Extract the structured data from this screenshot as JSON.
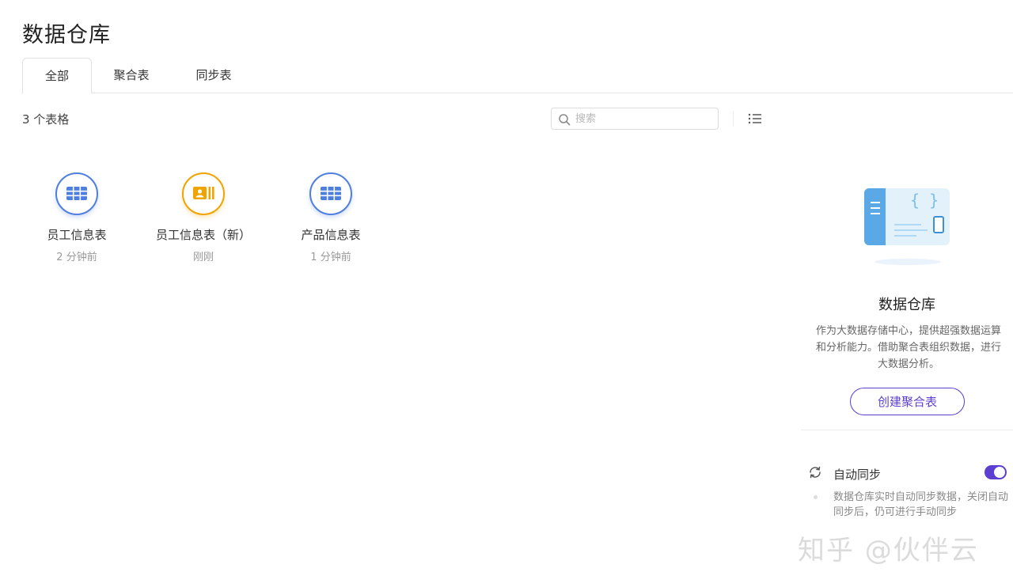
{
  "page": {
    "title": "数据仓库"
  },
  "tabs": [
    {
      "label": "全部",
      "active": true
    },
    {
      "label": "聚合表",
      "active": false
    },
    {
      "label": "同步表",
      "active": false
    }
  ],
  "toolbar": {
    "count_text": "3 个表格",
    "search_placeholder": "搜索",
    "search_icon": "search-icon",
    "view_icon": "list-view-icon"
  },
  "tables": [
    {
      "name": "员工信息表",
      "time": "2 分钟前",
      "icon": "grid-table-icon",
      "color": "#4f7fde"
    },
    {
      "name": "员工信息表（新）",
      "time": "刚刚",
      "icon": "contact-card-icon",
      "color": "#f1a300"
    },
    {
      "name": "产品信息表",
      "time": "1 分钟前",
      "icon": "grid-table-icon",
      "color": "#4f7fde"
    }
  ],
  "side_panel": {
    "title": "数据仓库",
    "description": "作为大数据存储中心，提供超强数据运算和分析能力。借助聚合表组织数据，进行大数据分析。",
    "create_button": "创建聚合表",
    "sync_label": "自动同步",
    "sync_enabled": true,
    "sync_description": "数据仓库实时自动同步数据，关闭自动同步后，仍可进行手动同步"
  },
  "watermark": "知乎 @伙伴云",
  "colors": {
    "accent": "#5c3fd0",
    "blue": "#4f7fde",
    "orange": "#f1a300"
  }
}
